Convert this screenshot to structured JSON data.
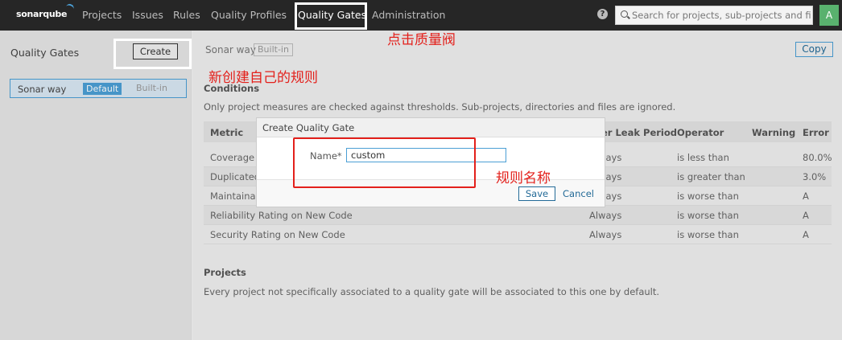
{
  "nav": {
    "logo": "sonarqube",
    "items": [
      "Projects",
      "Issues",
      "Rules",
      "Quality Profiles",
      "Quality Gates",
      "Administration"
    ],
    "help_icon": "?",
    "search_placeholder": "Search for projects, sub-projects and fil",
    "avatar_letter": "A"
  },
  "sidebar": {
    "title": "Quality Gates",
    "create_label": "Create",
    "gate": {
      "name": "Sonar way",
      "default_badge": "Default",
      "builtin_badge": "Built-in"
    }
  },
  "main": {
    "gate_name": "Sonar way",
    "builtin_badge": "Built-in",
    "copy_label": "Copy",
    "conditions_heading": "Conditions",
    "conditions_note": "Only project measures are checked against thresholds. Sub-projects, directories and files are ignored.",
    "columns": [
      "Metric",
      "er Leak Period",
      "Operator",
      "Warning",
      "Error"
    ],
    "rows": [
      {
        "metric": "Coverage o",
        "period": "Always",
        "operator": "is less than",
        "warning": "",
        "error": "80.0%"
      },
      {
        "metric": "Duplicated",
        "period": "Always",
        "operator": "is greater than",
        "warning": "",
        "error": "3.0%"
      },
      {
        "metric": "Maintainab",
        "period": "Always",
        "operator": "is worse than",
        "warning": "",
        "error": "A"
      },
      {
        "metric": "Reliability Rating on New Code",
        "period": "Always",
        "operator": "is worse than",
        "warning": "",
        "error": "A"
      },
      {
        "metric": "Security Rating on New Code",
        "period": "Always",
        "operator": "is worse than",
        "warning": "",
        "error": "A"
      }
    ],
    "projects_heading": "Projects",
    "projects_note": "Every project not specifically associated to a quality gate will be associated to this one by default."
  },
  "modal": {
    "title": "Create Quality Gate",
    "name_label": "Name*",
    "name_value": "custom",
    "save_label": "Save",
    "cancel_label": "Cancel"
  },
  "annotations": {
    "click_quality_gate": "点击质量阀",
    "create_own_rule": "新创建自己的规则",
    "rule_name": "规则名称",
    "highlight_white": "#ffffff",
    "highlight_red": "#e3201b"
  }
}
